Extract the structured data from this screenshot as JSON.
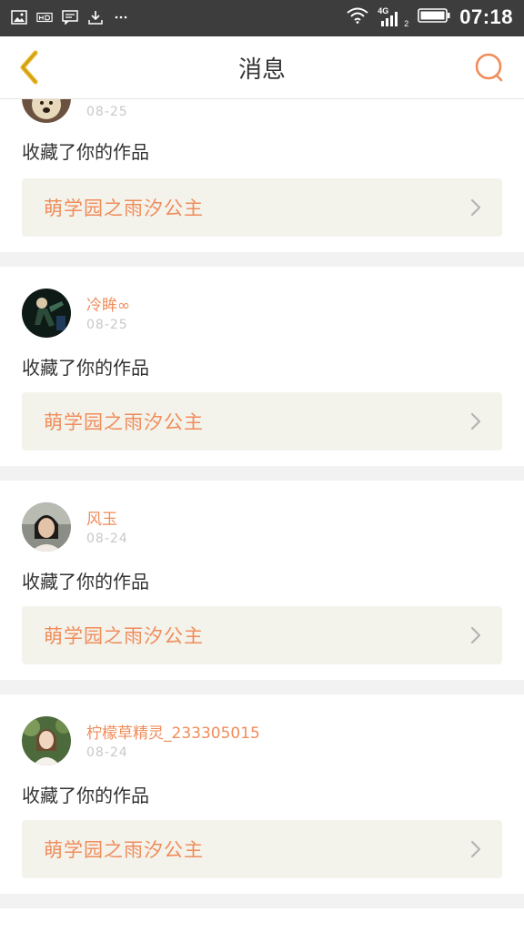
{
  "status_bar": {
    "time": "07:18",
    "network": "4G",
    "sim_slot": "2",
    "left_icons": [
      "image-icon",
      "hd-icon",
      "message-icon",
      "download-icon",
      "more-icon"
    ],
    "right_icons": [
      "wifi-icon",
      "signal-icon",
      "battery-icon"
    ]
  },
  "header": {
    "title": "消息",
    "back_icon": "chevron-left-icon",
    "search_icon": "search-icon"
  },
  "colors": {
    "accent": "#f08c5a",
    "back_arrow": "#e8b41e",
    "status_bar_bg": "#3d3d3d",
    "work_link_bg": "#f3f3ec",
    "date_text": "#c8c8c8",
    "page_bg": "#f2f2f2"
  },
  "messages": [
    {
      "username": "",
      "date": "08-25",
      "action": "收藏了你的作品",
      "work_title": "萌学园之雨汐公主"
    },
    {
      "username": "冷眸∞",
      "date": "08-25",
      "action": "收藏了你的作品",
      "work_title": "萌学园之雨汐公主"
    },
    {
      "username": "风玉",
      "date": "08-24",
      "action": "收藏了你的作品",
      "work_title": "萌学园之雨汐公主"
    },
    {
      "username": "柠檬草精灵_233305015",
      "date": "08-24",
      "action": "收藏了你的作品",
      "work_title": "萌学园之雨汐公主"
    }
  ]
}
